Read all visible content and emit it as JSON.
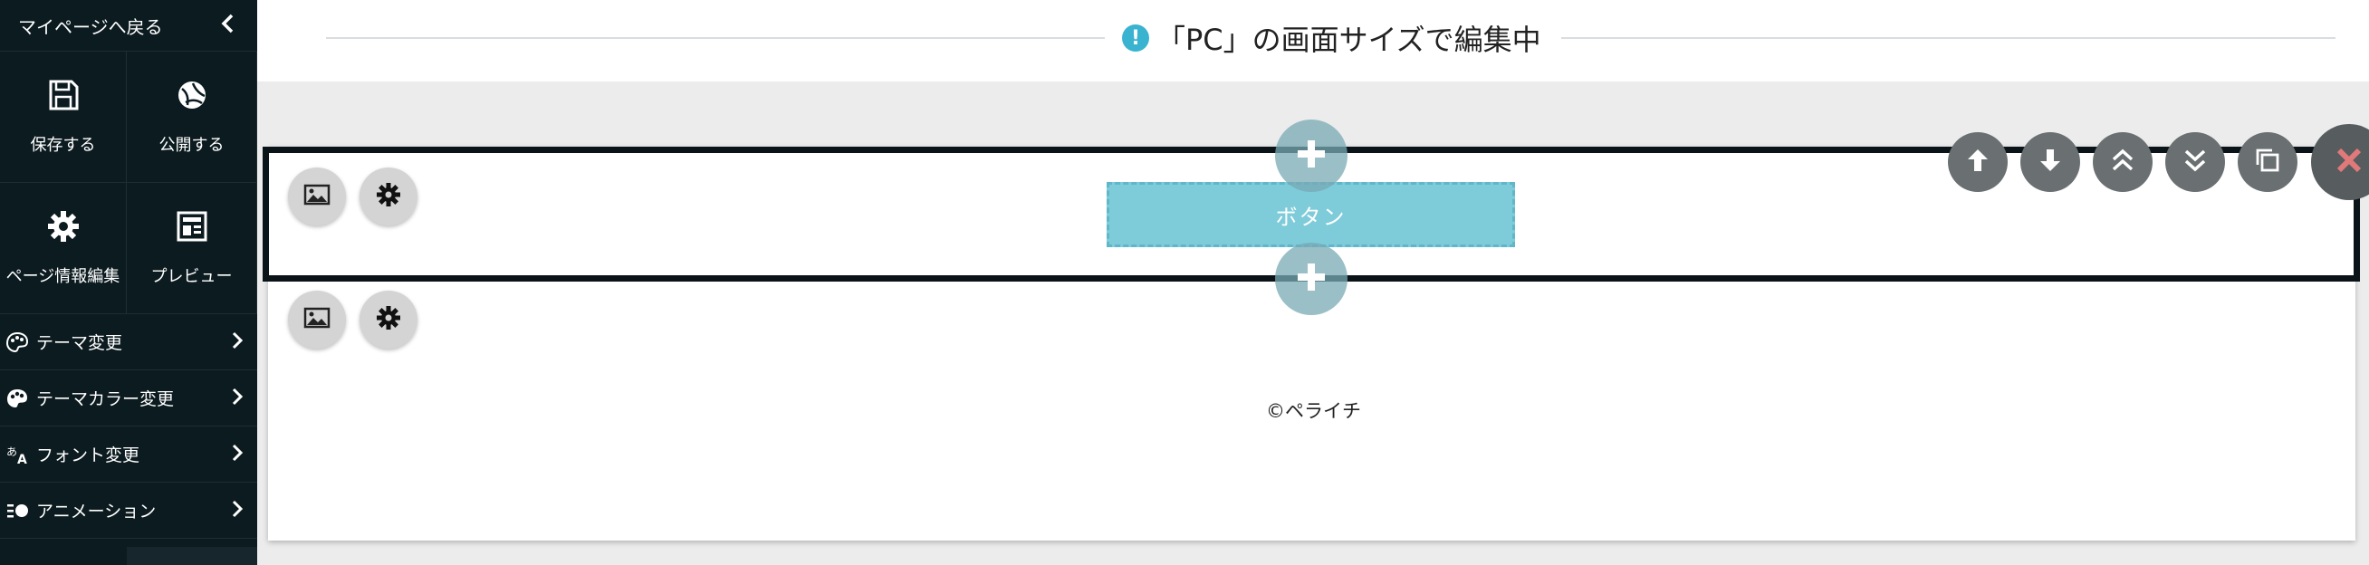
{
  "sidebar": {
    "back_label": "マイページへ戻る",
    "tiles": [
      {
        "label": "保存する",
        "icon": "save-icon"
      },
      {
        "label": "公開する",
        "icon": "publish-icon"
      },
      {
        "label": "ページ情報編集",
        "icon": "gear-icon"
      },
      {
        "label": "プレビュー",
        "icon": "preview-icon"
      }
    ],
    "menu": [
      {
        "label": "テーマ変更",
        "icon": "palette-icon"
      },
      {
        "label": "テーマカラー変更",
        "icon": "color-palette-icon"
      },
      {
        "label": "フォント変更",
        "icon": "font-icon"
      },
      {
        "label": "アニメーション",
        "icon": "animation-icon"
      }
    ]
  },
  "header": {
    "screen_notice": "「PC」の画面サイズで編集中",
    "notice_icon": "!"
  },
  "editor": {
    "button_label": "ボタン",
    "footer_text": "©ペライチ",
    "controls": [
      "move-up-icon",
      "move-down-icon",
      "move-top-icon",
      "move-bottom-icon",
      "duplicate-icon",
      "delete-icon"
    ]
  },
  "colors": {
    "sidebar_bg": "#0c1b20",
    "accent": "#3ab3d1",
    "button_bg": "#7ecbd9",
    "delete": "#e0797a"
  }
}
